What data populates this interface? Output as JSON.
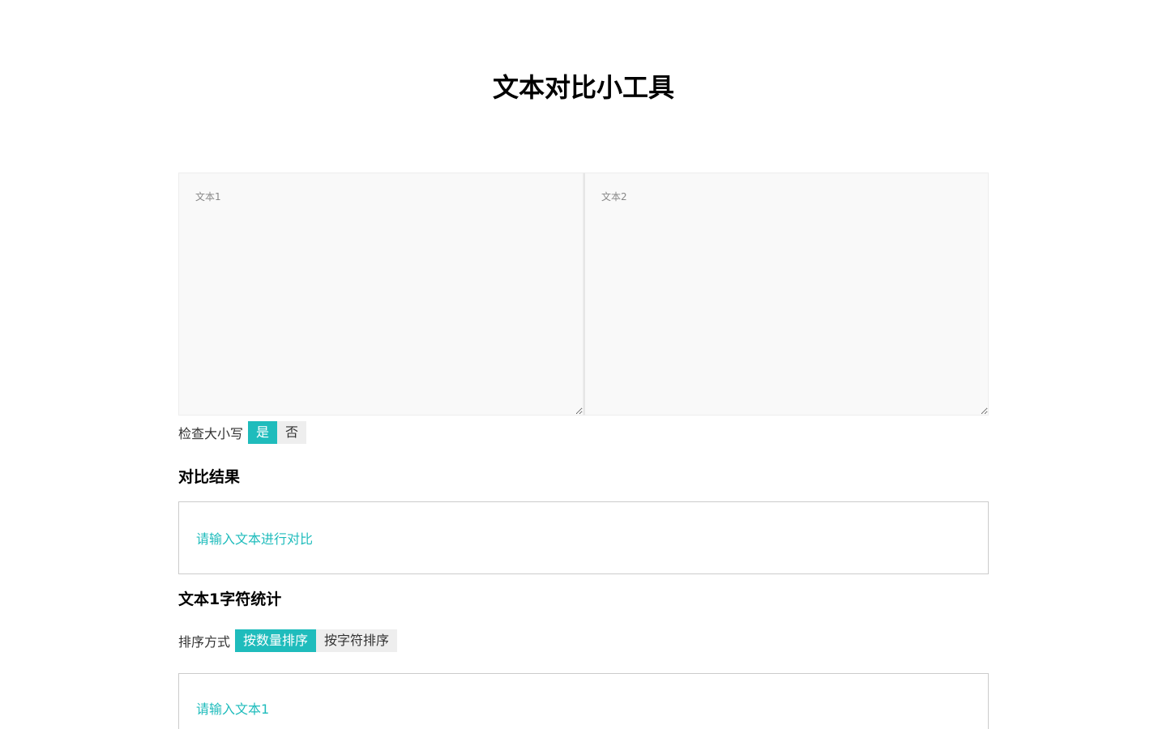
{
  "title": "文本对比小工具",
  "inputs": {
    "text1_placeholder": "文本1",
    "text1_value": "",
    "text2_placeholder": "文本2",
    "text2_value": ""
  },
  "case_check": {
    "label": "检查大小写",
    "yes_label": "是",
    "no_label": "否",
    "selected": "是"
  },
  "result": {
    "heading": "对比结果",
    "message": "请输入文本进行对比"
  },
  "stats": {
    "heading": "文本1字符统计",
    "sort_label": "排序方式",
    "sort_by_count": "按数量排序",
    "sort_by_char": "按字符排序",
    "selected": "按数量排序",
    "message": "请输入文本1"
  },
  "colors": {
    "accent": "#1fbcbc",
    "inactive": "#eeeeee",
    "textarea_bg": "#f9f9f9",
    "border": "#cccccc"
  }
}
